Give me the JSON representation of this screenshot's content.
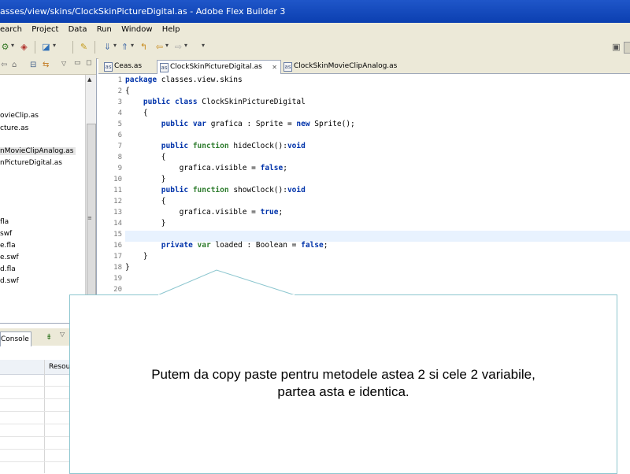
{
  "window": {
    "title": "asses/view/skins/ClockSkinPictureDigital.as - Adobe Flex Builder 3"
  },
  "menu": {
    "items": [
      "earch",
      "Project",
      "Data",
      "Run",
      "Window",
      "Help"
    ]
  },
  "left_panel": {
    "files": [
      "ovieClip.as",
      "cture.as",
      "nMovieClipAnalog.as",
      "nPictureDigital.as",
      "fla",
      "swf",
      "e.fla",
      "e.swf",
      "d.fla",
      "d.swf"
    ],
    "selected_index": 2
  },
  "console_panel": {
    "tab_label": "Console",
    "column_header": "Resou"
  },
  "editor": {
    "tabs": [
      {
        "label": "Ceas.as",
        "active": false
      },
      {
        "label": "ClockSkinPictureDigital.as",
        "active": true
      },
      {
        "label": "ClockSkinMovieClipAnalog.as",
        "active": false
      }
    ],
    "tab_close_glyph": "✕",
    "lines": [
      {
        "n": "1",
        "text": "package classes.view.skins"
      },
      {
        "n": "2",
        "text": "{"
      },
      {
        "n": "3",
        "text": "    public class ClockSkinPictureDigital"
      },
      {
        "n": "4",
        "text": "    {"
      },
      {
        "n": "5",
        "text": "        public var grafica : Sprite = new Sprite();"
      },
      {
        "n": "6",
        "text": ""
      },
      {
        "n": "7",
        "text": "        public function hideClock():void"
      },
      {
        "n": "8",
        "text": "        {"
      },
      {
        "n": "9",
        "text": "            grafica.visible = false;"
      },
      {
        "n": "10",
        "text": "        }"
      },
      {
        "n": "11",
        "text": "        public function showClock():void"
      },
      {
        "n": "12",
        "text": "        {"
      },
      {
        "n": "13",
        "text": "            grafica.visible = true;"
      },
      {
        "n": "14",
        "text": "        }"
      },
      {
        "n": "15",
        "text": ""
      },
      {
        "n": "16",
        "text": "        private var loaded : Boolean = false;"
      },
      {
        "n": "17",
        "text": "    }"
      },
      {
        "n": "18",
        "text": "}"
      },
      {
        "n": "19",
        "text": ""
      },
      {
        "n": "20",
        "text": ""
      }
    ],
    "current_line": 15
  },
  "callout": {
    "text_line1": "Putem da copy paste pentru metodele astea 2 si cele 2 variabile,",
    "text_line2": "partea asta e identica."
  },
  "colors": {
    "titlebar": "#0b3fb0",
    "chrome": "#ece9d8",
    "keyword": "#0033aa",
    "callout_border": "#8cc6cf",
    "current_line": "#e8f2fe"
  }
}
